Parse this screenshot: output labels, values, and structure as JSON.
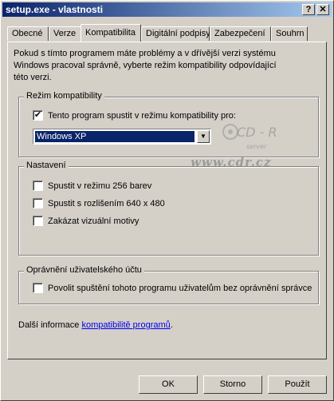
{
  "window": {
    "title": "setup.exe - vlastnosti"
  },
  "titlebar_buttons": {
    "help": "?",
    "close": "✕"
  },
  "tabs": [
    {
      "label": "Obecné"
    },
    {
      "label": "Verze"
    },
    {
      "label": "Kompatibilita"
    },
    {
      "label": "Digitální podpisy"
    },
    {
      "label": "Zabezpečení"
    },
    {
      "label": "Souhrn"
    }
  ],
  "intro": "Pokud s tímto programem máte problémy a v dřívější verzi systému Windows pracoval správně, vyberte režim kompatibility odpovídající této verzi.",
  "compat_group": {
    "legend": "Režim kompatibility",
    "checkbox_label": "Tento program spustit v režimu kompatibility pro:",
    "checked": true,
    "selected_os": "Windows XP"
  },
  "settings_group": {
    "legend": "Nastavení",
    "options": [
      {
        "label": "Spustit v režimu 256 barev",
        "checked": false
      },
      {
        "label": "Spustit s rozlišením 640 x 480",
        "checked": false
      },
      {
        "label": "Zakázat vizuální motivy",
        "checked": false
      }
    ]
  },
  "uac_group": {
    "legend": "Oprávnění uživatelského účtu",
    "checkbox_label": "Povolit spuštění tohoto programu uživatelům bez oprávnění správce",
    "checked": false
  },
  "more_info": {
    "prefix": "Další informace ",
    "link": "kompatibilitě programů",
    "suffix": "."
  },
  "buttons": {
    "ok": "OK",
    "cancel": "Storno",
    "apply": "Použít"
  },
  "watermark": {
    "logo": "CD - R",
    "sub": "server",
    "url": "www.cdr.cz"
  },
  "accent_color": "#0a246a"
}
